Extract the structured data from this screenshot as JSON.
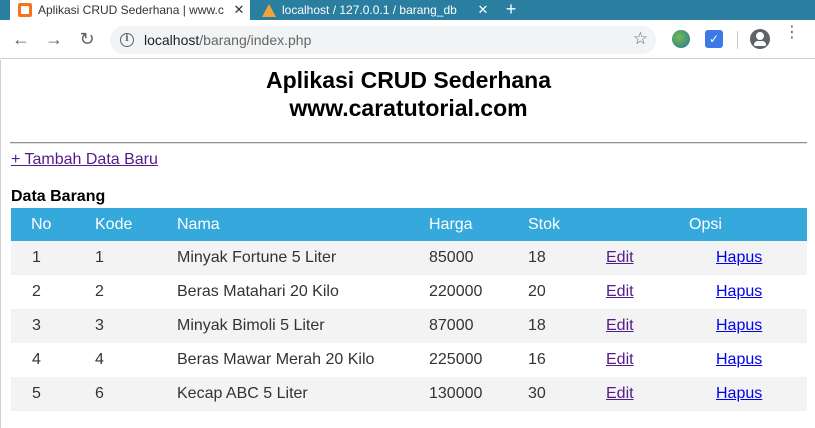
{
  "browser": {
    "tabs": [
      {
        "title": "Aplikasi CRUD Sederhana | www.c",
        "close": "✕"
      },
      {
        "title": "localhost / 127.0.0.1 / barang_db",
        "close": "✕"
      }
    ],
    "new_tab": "+",
    "url_host": "localhost",
    "url_path": "/barang/index.php",
    "nav": {
      "back": "←",
      "forward": "→",
      "reload": "↻"
    },
    "icons": {
      "star": "☆",
      "menu": "⋮",
      "check": "✓"
    }
  },
  "page": {
    "title_line1": "Aplikasi CRUD Sederhana",
    "title_line2": "www.caratutorial.com",
    "add_link": "+ Tambah Data Baru",
    "section_title": "Data Barang"
  },
  "table": {
    "headers": {
      "no": "No",
      "kode": "Kode",
      "nama": "Nama",
      "harga": "Harga",
      "stok": "Stok",
      "opsi": "Opsi"
    },
    "edit_label": "Edit",
    "delete_label": "Hapus",
    "rows": [
      {
        "no": "1",
        "kode": "1",
        "nama": "Minyak Fortune 5 Liter",
        "harga": "85000",
        "stok": "18"
      },
      {
        "no": "2",
        "kode": "2",
        "nama": "Beras Matahari 20 Kilo",
        "harga": "220000",
        "stok": "20"
      },
      {
        "no": "3",
        "kode": "3",
        "nama": "Minyak Bimoli 5 Liter",
        "harga": "87000",
        "stok": "18"
      },
      {
        "no": "4",
        "kode": "4",
        "nama": "Beras Mawar Merah 20 Kilo",
        "harga": "225000",
        "stok": "16"
      },
      {
        "no": "5",
        "kode": "6",
        "nama": "Kecap ABC 5 Liter",
        "harga": "130000",
        "stok": "30"
      }
    ]
  },
  "colors": {
    "tabstrip": "#2a7ea0",
    "table_header": "#35a8dc",
    "visited_link": "#551a8b",
    "link": "#0000ee"
  }
}
